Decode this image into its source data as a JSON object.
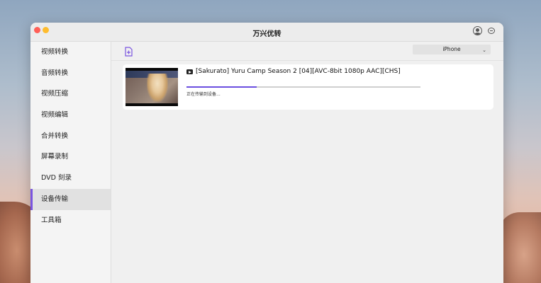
{
  "app": {
    "title": "万兴优转"
  },
  "sidebar": {
    "items": [
      {
        "label": "视频转换",
        "active": false
      },
      {
        "label": "音频转换",
        "active": false
      },
      {
        "label": "视频压缩",
        "active": false
      },
      {
        "label": "视频编辑",
        "active": false
      },
      {
        "label": "合并转换",
        "active": false
      },
      {
        "label": "屏幕录制",
        "active": false
      },
      {
        "label": "DVD 刻录",
        "active": false
      },
      {
        "label": "设备传输",
        "active": true
      },
      {
        "label": "工具箱",
        "active": false
      }
    ]
  },
  "toolbar": {
    "add_file_icon": "add-file-icon",
    "device_selected": "iPhone"
  },
  "file": {
    "name": "[Sakurato] Yuru Camp Season 2 [04][AVC-8bit 1080p AAC][CHS]",
    "status": "正在传输到设备...",
    "progress": 0.3
  },
  "colors": {
    "accent": "#6b4fe0",
    "active_bg": "#e1e1e1",
    "close": "#ff5f57",
    "minimize": "#febc2e"
  }
}
